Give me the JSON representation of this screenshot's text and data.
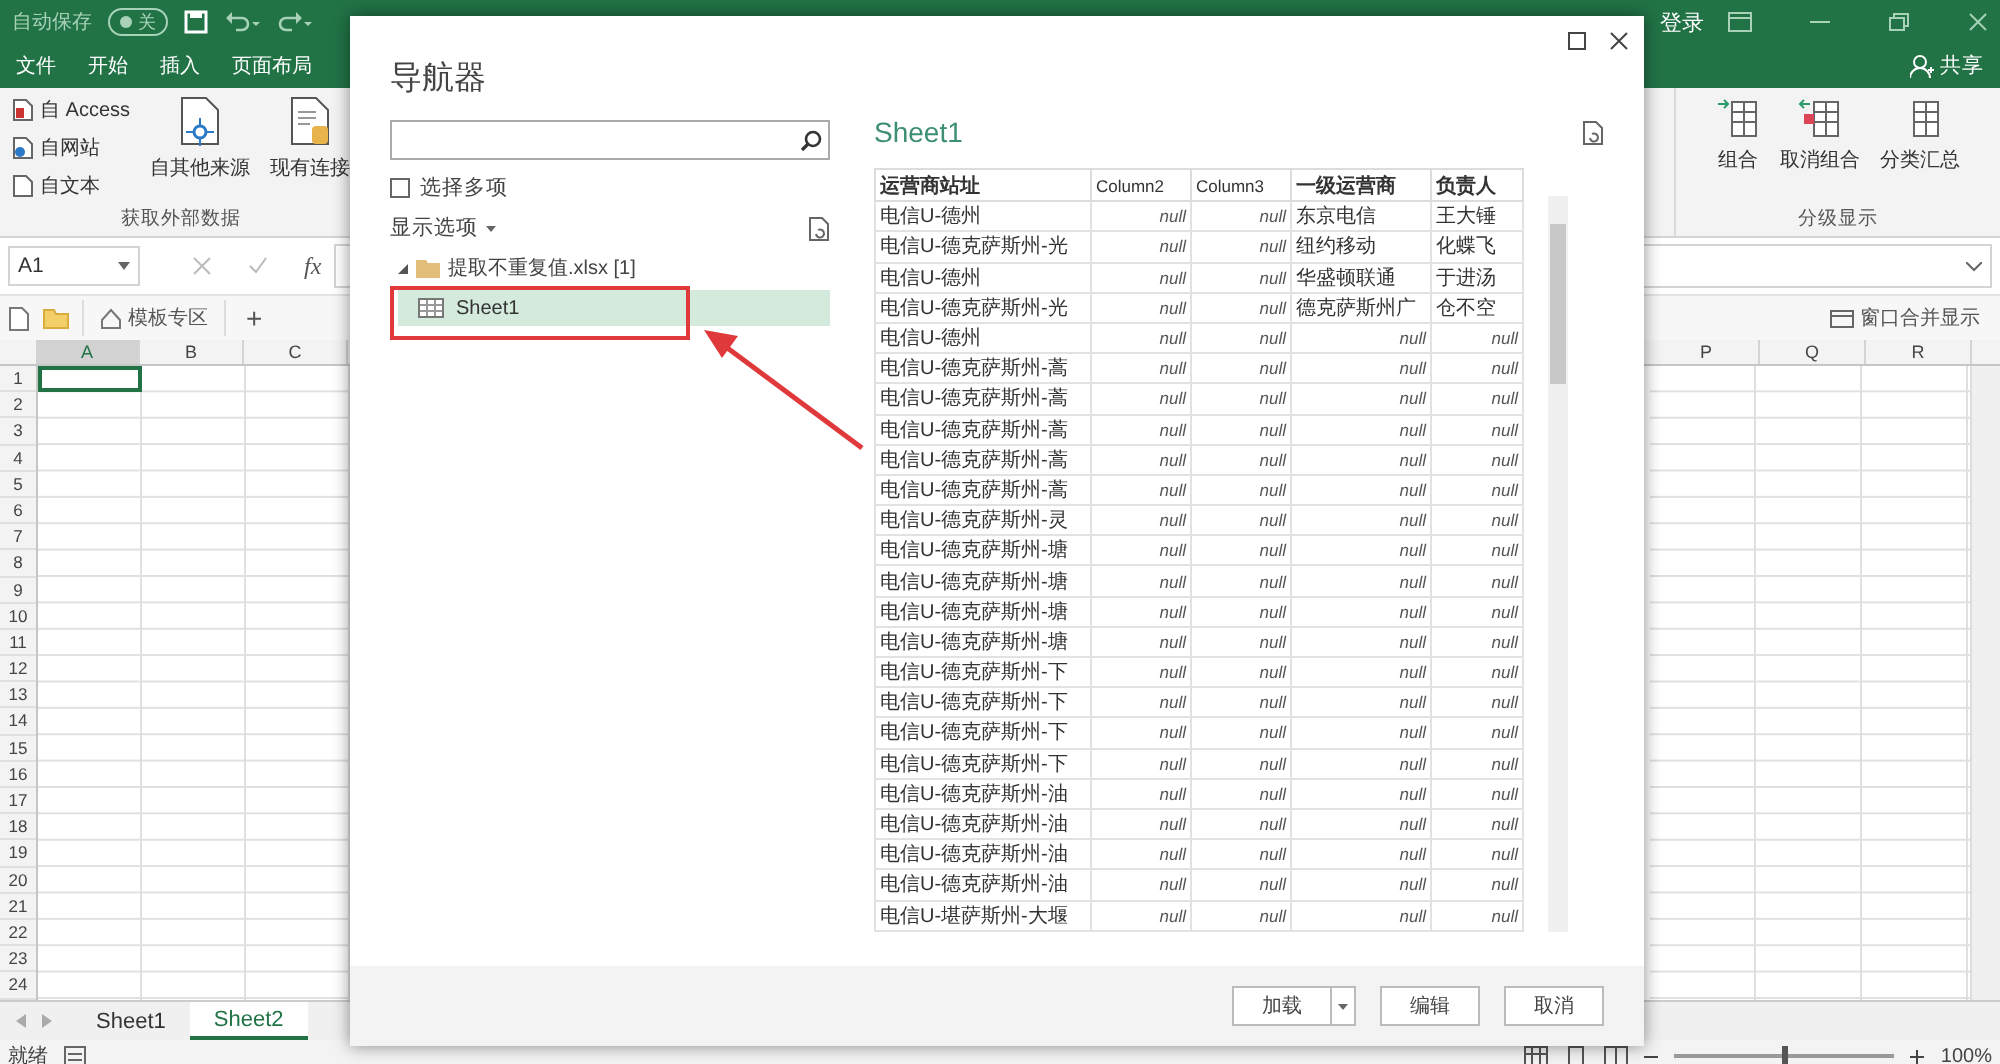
{
  "excel": {
    "title_bar": {
      "autosave": "自动保存",
      "autosave_state": "关",
      "login": "登录"
    },
    "menu_tabs": [
      {
        "label": "文件"
      },
      {
        "label": "开始"
      },
      {
        "label": "插入"
      },
      {
        "label": "页面布局"
      }
    ],
    "share": "共享",
    "ribbon_left": {
      "small_buttons": [
        "自 Access",
        "自网站",
        "自文本"
      ],
      "large_buttons": [
        "自其他来源",
        "现有连接"
      ],
      "group_label": "获取外部数据"
    },
    "ribbon_right": {
      "large_buttons": [
        "组合",
        "取消组合",
        "分类汇总"
      ],
      "group_label": "分级显示"
    },
    "name_box": "A1",
    "fx": "fx",
    "doc_tabs": {
      "template": "模板专区",
      "plus": "+",
      "merge": "窗口合并显示"
    },
    "columns_left": [
      "A",
      "B",
      "C"
    ],
    "columns_right": [
      "P",
      "Q",
      "R"
    ],
    "rows": [
      "1",
      "2",
      "3",
      "4",
      "5",
      "6",
      "7",
      "8",
      "9",
      "10",
      "11",
      "12",
      "13",
      "14",
      "15",
      "16",
      "17",
      "18",
      "19",
      "20",
      "21",
      "22",
      "23",
      "24"
    ],
    "sheets": [
      {
        "label": "Sheet1",
        "selected": false
      },
      {
        "label": "Sheet2",
        "selected": true
      }
    ],
    "status": "就绪",
    "zoom_slider": {
      "level": 0.5
    },
    "zoom": "100%"
  },
  "dialog": {
    "title": "导航器",
    "multi_select": {
      "label": "选择多项",
      "checked": false
    },
    "display_options": "显示选项",
    "tree": [
      {
        "label": "提取不重复值.xlsx [1]",
        "expanded": true,
        "children": [
          {
            "label": "Sheet1",
            "selected": true
          }
        ]
      }
    ],
    "preview": {
      "title": "Sheet1",
      "columns": [
        "运营商站址",
        "Column2",
        "Column3",
        "一级运营商",
        "负责人"
      ],
      "rows": [
        [
          "电信U-德州",
          "null",
          "null",
          "东京电信",
          "王大锤"
        ],
        [
          "电信U-德克萨斯州-光",
          "null",
          "null",
          "纽约移动",
          "化蝶飞"
        ],
        [
          "电信U-德州",
          "null",
          "null",
          "华盛顿联通",
          "于进汤"
        ],
        [
          "电信U-德克萨斯州-光",
          "null",
          "null",
          "德克萨斯州广",
          "仓不空"
        ],
        [
          "电信U-德州",
          "null",
          "null",
          "null",
          "null"
        ],
        [
          "电信U-德克萨斯州-蒿",
          "null",
          "null",
          "null",
          "null"
        ],
        [
          "电信U-德克萨斯州-蒿",
          "null",
          "null",
          "null",
          "null"
        ],
        [
          "电信U-德克萨斯州-蒿",
          "null",
          "null",
          "null",
          "null"
        ],
        [
          "电信U-德克萨斯州-蒿",
          "null",
          "null",
          "null",
          "null"
        ],
        [
          "电信U-德克萨斯州-蒿",
          "null",
          "null",
          "null",
          "null"
        ],
        [
          "电信U-德克萨斯州-灵",
          "null",
          "null",
          "null",
          "null"
        ],
        [
          "电信U-德克萨斯州-塘",
          "null",
          "null",
          "null",
          "null"
        ],
        [
          "电信U-德克萨斯州-塘",
          "null",
          "null",
          "null",
          "null"
        ],
        [
          "电信U-德克萨斯州-塘",
          "null",
          "null",
          "null",
          "null"
        ],
        [
          "电信U-德克萨斯州-塘",
          "null",
          "null",
          "null",
          "null"
        ],
        [
          "电信U-德克萨斯州-下",
          "null",
          "null",
          "null",
          "null"
        ],
        [
          "电信U-德克萨斯州-下",
          "null",
          "null",
          "null",
          "null"
        ],
        [
          "电信U-德克萨斯州-下",
          "null",
          "null",
          "null",
          "null"
        ],
        [
          "电信U-德克萨斯州-下",
          "null",
          "null",
          "null",
          "null"
        ],
        [
          "电信U-德克萨斯州-油",
          "null",
          "null",
          "null",
          "null"
        ],
        [
          "电信U-德克萨斯州-油",
          "null",
          "null",
          "null",
          "null"
        ],
        [
          "电信U-德克萨斯州-油",
          "null",
          "null",
          "null",
          "null"
        ],
        [
          "电信U-德克萨斯州-油",
          "null",
          "null",
          "null",
          "null"
        ],
        [
          "电信U-堪萨斯州-大堰",
          "null",
          "null",
          "null",
          "null"
        ]
      ]
    },
    "buttons": [
      {
        "label": "加载",
        "kind": "split"
      },
      {
        "label": "编辑",
        "kind": "plain"
      },
      {
        "label": "取消",
        "kind": "plain"
      }
    ]
  }
}
